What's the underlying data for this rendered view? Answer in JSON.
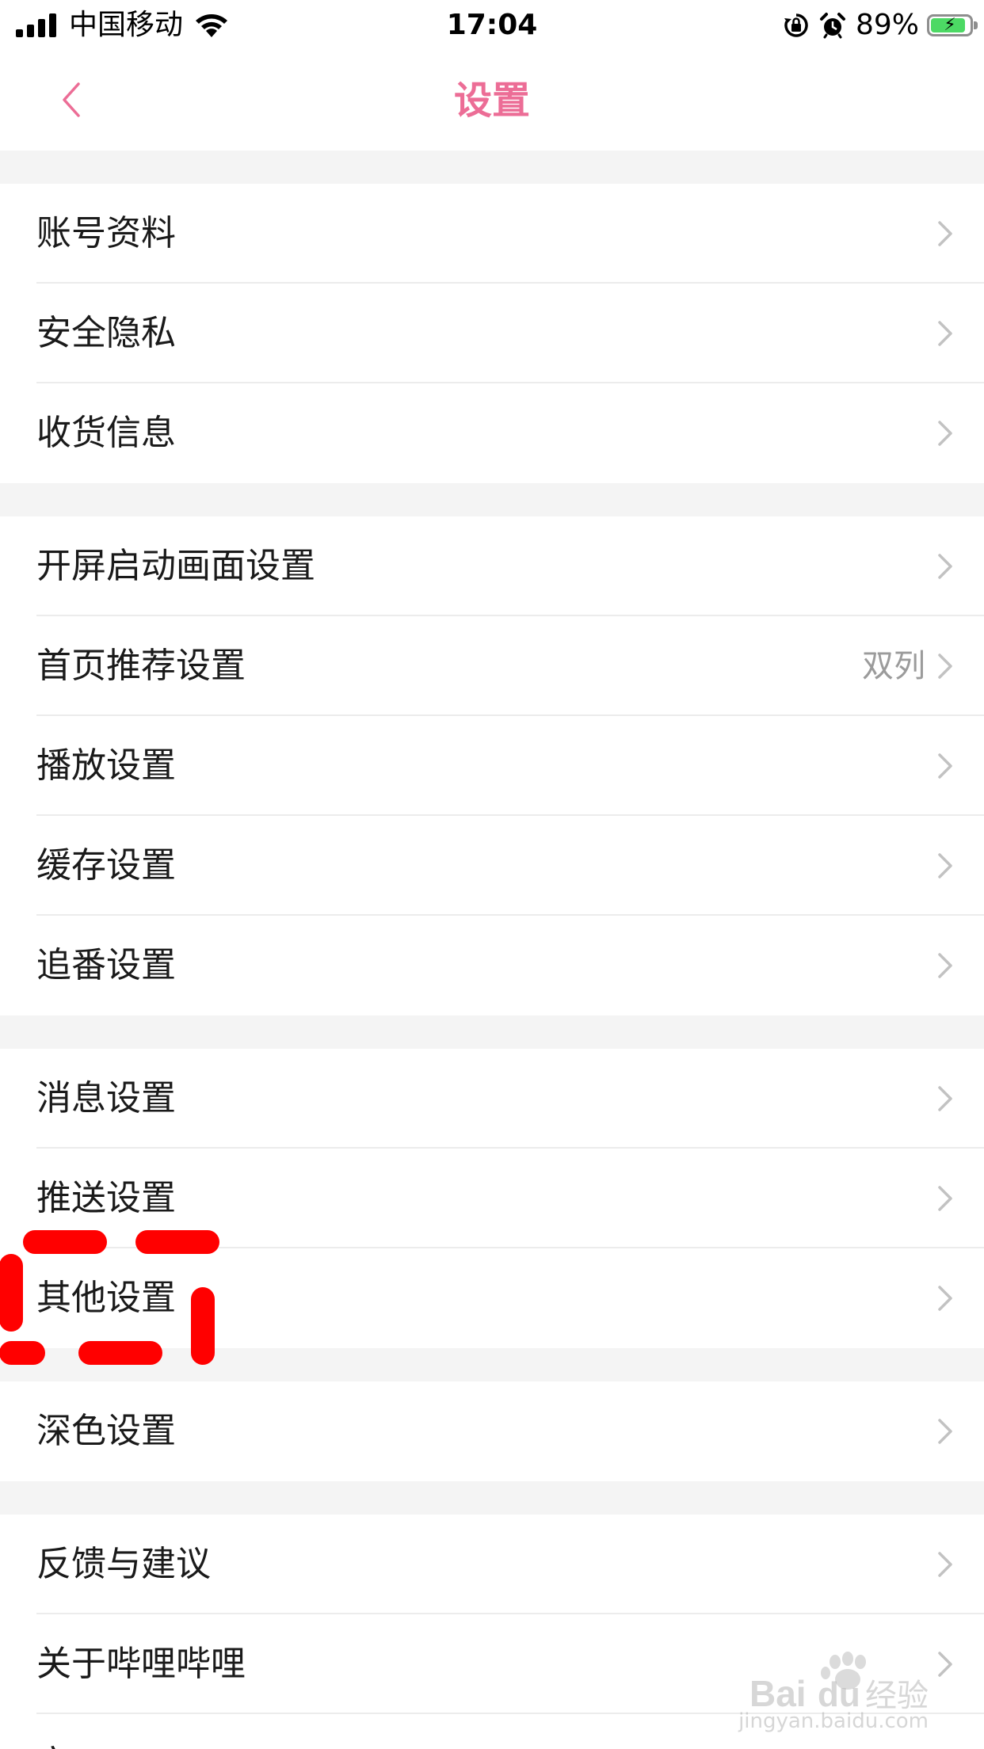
{
  "status_bar": {
    "carrier": "中国移动",
    "time": "17:04",
    "battery_percent": "89%",
    "battery_level": 0.89,
    "icons": [
      "signal-icon",
      "wifi-icon",
      "orientation-lock-icon",
      "alarm-icon",
      "battery-charging-icon"
    ]
  },
  "nav": {
    "back_icon": "chevron-left-icon",
    "title": "设置"
  },
  "colors": {
    "accent": "#ec6d96",
    "annotation": "#ff0000",
    "background": "#f4f4f4"
  },
  "groups": [
    {
      "items": [
        {
          "label": "账号资料"
        },
        {
          "label": "安全隐私"
        },
        {
          "label": "收货信息"
        }
      ]
    },
    {
      "items": [
        {
          "label": "开屏启动画面设置"
        },
        {
          "label": "首页推荐设置",
          "value": "双列"
        },
        {
          "label": "播放设置"
        },
        {
          "label": "缓存设置"
        },
        {
          "label": "追番设置"
        }
      ]
    },
    {
      "items": [
        {
          "label": "消息设置"
        },
        {
          "label": "推送设置"
        },
        {
          "label": "其他设置",
          "highlighted": true
        }
      ]
    },
    {
      "items": [
        {
          "label": "深色设置"
        }
      ]
    },
    {
      "items": [
        {
          "label": "反馈与建议"
        },
        {
          "label": "关于哔哩哔哩"
        },
        {
          "label": "安"
        }
      ]
    }
  ],
  "watermark": {
    "icon": "baidu-paw-icon",
    "text": "Bai",
    "text2": "du",
    "text3": "经验",
    "sub": "jingyan.baidu.com"
  }
}
